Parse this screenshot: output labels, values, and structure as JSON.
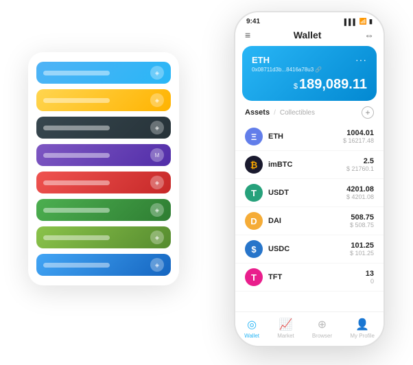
{
  "scene": {
    "back_panel": {
      "cards": [
        {
          "color": "card-blue",
          "icon": "◈"
        },
        {
          "color": "card-yellow",
          "icon": "◈"
        },
        {
          "color": "card-dark",
          "icon": "◈"
        },
        {
          "color": "card-purple",
          "icon": "M"
        },
        {
          "color": "card-red",
          "icon": "◈"
        },
        {
          "color": "card-green",
          "icon": "◈"
        },
        {
          "color": "card-lightgreen",
          "icon": "◈"
        },
        {
          "color": "card-lightblue",
          "icon": "◈"
        }
      ]
    },
    "phone": {
      "status_bar": {
        "time": "9:41",
        "signal": "▌▌▌",
        "wifi": "WiFi",
        "battery": "🔋"
      },
      "header": {
        "menu_icon": "≡",
        "title": "Wallet",
        "expand_icon": "⇔"
      },
      "eth_card": {
        "label": "ETH",
        "dots": "···",
        "address": "0x08711d3b...8416a78u3 🔗",
        "currency_symbol": "$",
        "balance": "189,089.11"
      },
      "assets_section": {
        "tab_active": "Assets",
        "divider": "/",
        "tab_inactive": "Collectibles",
        "add_icon": "+"
      },
      "assets": [
        {
          "name": "ETH",
          "icon": "Ξ",
          "coin_class": "eth-coin",
          "amount": "1004.01",
          "usd": "$ 16217.48"
        },
        {
          "name": "imBTC",
          "icon": "₿",
          "coin_class": "imbtc-coin",
          "amount": "2.5",
          "usd": "$ 21760.1"
        },
        {
          "name": "USDT",
          "icon": "₮",
          "coin_class": "usdt-coin",
          "amount": "4201.08",
          "usd": "$ 4201.08"
        },
        {
          "name": "DAI",
          "icon": "◈",
          "coin_class": "dai-coin",
          "amount": "508.75",
          "usd": "$ 508.75"
        },
        {
          "name": "USDC",
          "icon": "$",
          "coin_class": "usdc-coin",
          "amount": "101.25",
          "usd": "$ 101.25"
        },
        {
          "name": "TFT",
          "icon": "🌿",
          "coin_class": "tft-coin",
          "amount": "13",
          "usd": "0"
        }
      ],
      "nav": {
        "items": [
          {
            "icon": "◎",
            "label": "Wallet",
            "active": true
          },
          {
            "icon": "📈",
            "label": "Market",
            "active": false
          },
          {
            "icon": "🌐",
            "label": "Browser",
            "active": false
          },
          {
            "icon": "👤",
            "label": "My Profile",
            "active": false
          }
        ]
      }
    }
  }
}
